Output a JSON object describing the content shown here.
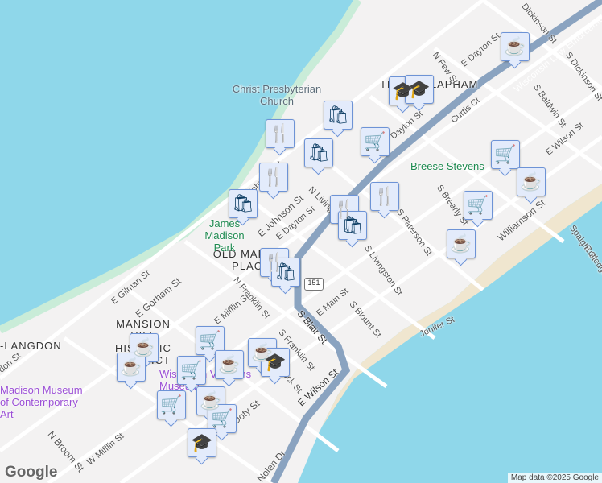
{
  "map": {
    "neighborhoods": [
      "TENNEY-LAPHAM",
      "OLD MARKET PLACE",
      "MANSION HILL HISTORIC DISTRICT",
      "-LANGDON"
    ],
    "pois": [
      {
        "name": "Christ Presbyterian Church",
        "color": "#5b6b78"
      },
      {
        "name": "Breese Stevens",
        "color": "#1e8a50"
      },
      {
        "name": "James Madison Park",
        "color": "#1e8a50"
      },
      {
        "name": "Wisconsin Veterans Museum",
        "color": "#9b4fd6"
      },
      {
        "name": "Madison Museum of Contemporary Art",
        "color": "#9b4fd6"
      }
    ],
    "streets": [
      "N Few St",
      "E Dayton St",
      "Dickinson St",
      "S Dickinson St",
      "Wisconsin Law Enforcement",
      "S Baldwin St",
      "Curtis Ct",
      "E Wilson St",
      "Williamson St",
      "Spaight St",
      "Rutledge",
      "S Brearly St",
      "S Paterson St",
      "S Livingston St",
      "N Livingston St",
      "E Johnson St",
      "E Dayton St",
      "N Franklin St",
      "E Gorham St",
      "E Gilman St",
      "E Mifflin St",
      "E Main St",
      "S Blount St",
      "S Blair St",
      "S Franklin St",
      "S Hancock St",
      "E Wilson St",
      "E Doty St",
      "N Broom St",
      "W Mifflin St",
      "Jenifer St",
      "Nolen Dr",
      "don St",
      "Johnson St",
      "Dayton St"
    ],
    "highway_shield": "151",
    "markers": [
      "coffee",
      "graduation-cap",
      "graduation-cap",
      "restaurant",
      "shopping-bag",
      "shopping-bag",
      "shopping-cart",
      "restaurant",
      "shopping-bag",
      "restaurant",
      "restaurant",
      "shopping-bag",
      "shopping-cart",
      "coffee",
      "shopping-cart",
      "coffee",
      "restaurant",
      "shopping-bag",
      "coffee",
      "coffee",
      "shopping-cart",
      "coffee",
      "shopping-cart",
      "coffee",
      "graduation-cap",
      "shopping-cart",
      "coffee",
      "shopping-cart",
      "graduation-cap"
    ],
    "attribution": "Map data ©2025 Google",
    "logo": "Google"
  }
}
